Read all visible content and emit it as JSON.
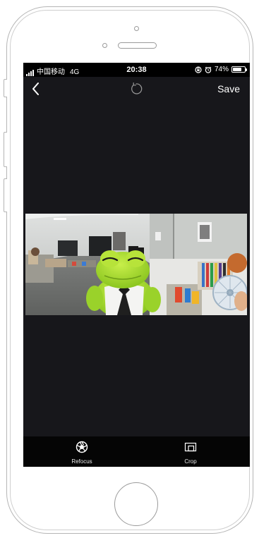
{
  "status_bar": {
    "carrier": "中国移动",
    "network": "4G",
    "time": "20:38",
    "battery": "74%",
    "battery_level": 0.74
  },
  "nav": {
    "back_icon": "chevron-left-icon",
    "rotate_icon": "rotate-icon",
    "save_label": "Save"
  },
  "photo": {
    "subject": "frog-plush-photo"
  },
  "toolbar": {
    "refocus_label": "Refocus",
    "refocus_icon": "aperture-icon",
    "crop_label": "Crop",
    "crop_icon": "crop-icon"
  },
  "colors": {
    "screen_bg": "#17171b",
    "status_bg": "#000000",
    "toolbar_bg": "#050505",
    "text": "#ffffff"
  }
}
